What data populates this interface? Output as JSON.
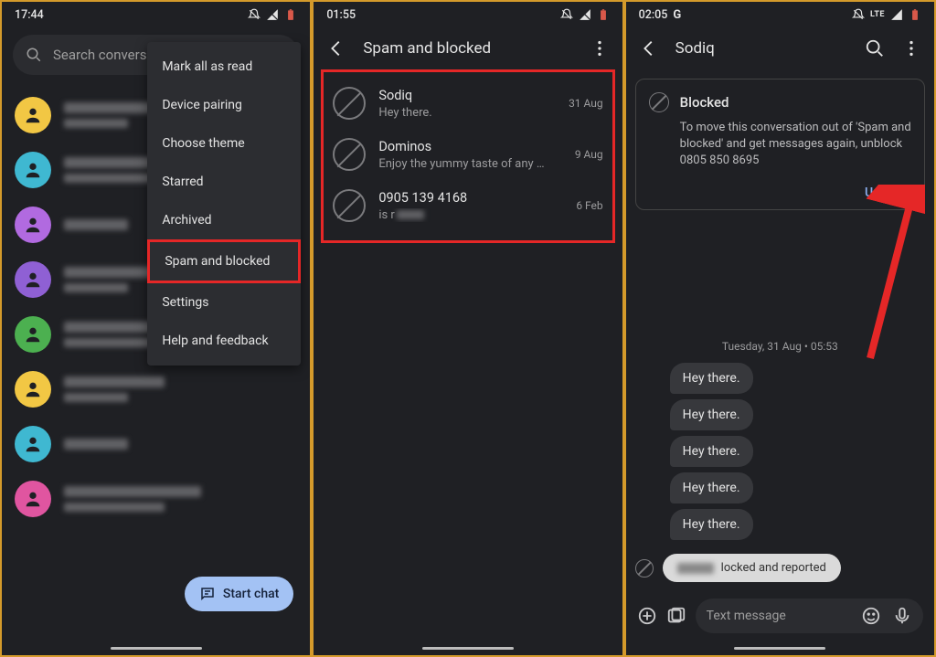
{
  "panel1": {
    "time": "17:44",
    "search_placeholder": "Search conversat",
    "menu": {
      "mark_read": "Mark all as read",
      "device_pairing": "Device pairing",
      "choose_theme": "Choose theme",
      "starred": "Starred",
      "archived": "Archived",
      "spam_blocked": "Spam and blocked",
      "settings": "Settings",
      "help": "Help and feedback"
    },
    "fab_label": "Start chat",
    "avatars": [
      "#f2c744",
      "#3fb8d1",
      "#b16ae0",
      "#8f60d4",
      "#4cb050",
      "#f2c744",
      "#3fb8d1",
      "#e055a0"
    ]
  },
  "panel2": {
    "time": "01:55",
    "title": "Spam and blocked",
    "items": [
      {
        "name": "Sodiq",
        "preview": "Hey there.",
        "date": "31 Aug"
      },
      {
        "name": "Dominos",
        "preview": "Enjoy the yummy taste of any Medium …",
        "date": "9 Aug"
      },
      {
        "name": "0905 139 4168",
        "preview": "is r",
        "date": "6 Feb"
      }
    ]
  },
  "panel3": {
    "time": "02:05",
    "g": "G",
    "lte": "LTE",
    "title": "Sodiq",
    "blocked": {
      "heading": "Blocked",
      "body": "To move this conversation out of 'Spam and blocked' and get messages again, unblock 0805 850 8695",
      "action": "Unblock"
    },
    "date_divider": "Tuesday, 31 Aug • 05:53",
    "bubbles": [
      "Hey there.",
      "Hey there.",
      "Hey there.",
      "Hey there.",
      "Hey there."
    ],
    "toast": "locked and reported",
    "compose_placeholder": "Text message"
  }
}
